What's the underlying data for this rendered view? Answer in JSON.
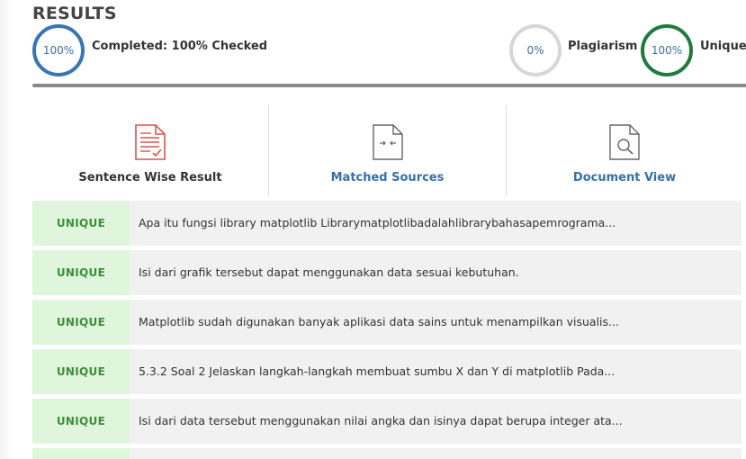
{
  "header": {
    "title": "RESULTS"
  },
  "stats": {
    "completed": {
      "circle": "100%",
      "label": "Completed: 100% Checked",
      "color": "#3a75b3"
    },
    "plagiarism": {
      "circle": "0%",
      "label": "Plagiarism",
      "color": "#d6d6d6"
    },
    "unique": {
      "circle": "100%",
      "label": "Unique",
      "color": "#1e7a3d"
    }
  },
  "tabs": [
    {
      "label": "Sentence Wise Result",
      "icon": "document-check-icon",
      "active": true
    },
    {
      "label": "Matched Sources",
      "icon": "compare-document-icon",
      "active": false
    },
    {
      "label": "Document View",
      "icon": "document-search-icon",
      "active": false
    }
  ],
  "rows": [
    {
      "status": "UNIQUE",
      "text": "Apa itu fungsi library matplotlib Librarymatplotlibadalahlibrarybahasapemrograma..."
    },
    {
      "status": "UNIQUE",
      "text": "Isi dari grafik tersebut dapat menggunakan data sesuai kebutuhan."
    },
    {
      "status": "UNIQUE",
      "text": "Matplotlib sudah digunakan banyak aplikasi data sains untuk menampilkan visualis..."
    },
    {
      "status": "UNIQUE",
      "text": "5.3.2 Soal 2 Jelaskan langkah-langkah membuat sumbu X dan Y di matplotlib Pada..."
    },
    {
      "status": "UNIQUE",
      "text": "Isi dari data tersebut menggunakan nilai angka dan isinya dapat berupa integer ata..."
    }
  ],
  "colors": {
    "unique_badge_bg": "#dff5dc",
    "unique_badge_text": "#3f8d3c",
    "link_blue": "#3a6ea5",
    "icon_red": "#d9534f"
  }
}
